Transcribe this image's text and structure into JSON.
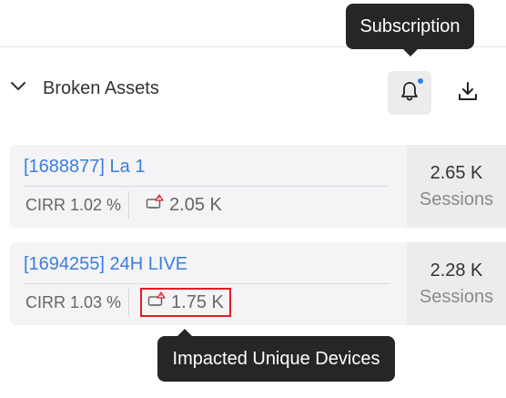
{
  "tooltips": {
    "bell": "Subscription",
    "devices": "Impacted Unique Devices"
  },
  "section": {
    "title": "Broken Assets",
    "expanded": true,
    "icons": [
      "chevron-down-icon",
      "bell-icon",
      "download-icon"
    ]
  },
  "assets": [
    {
      "name": "[1688877] La 1",
      "cirr": "CIRR 1.02 %",
      "devices": "2.05 K",
      "sessions_value": "2.65 K",
      "sessions_label": "Sessions",
      "highlighted": false
    },
    {
      "name": "[1694255] 24H LIVE",
      "cirr": "CIRR 1.03 %",
      "devices": "1.75 K",
      "sessions_value": "2.28 K",
      "sessions_label": "Sessions",
      "highlighted": true
    }
  ],
  "colors": {
    "link": "#3b7de0",
    "tooltip_bg": "#262626",
    "highlight": "#e01b24",
    "notification_dot": "#3b7de0"
  }
}
